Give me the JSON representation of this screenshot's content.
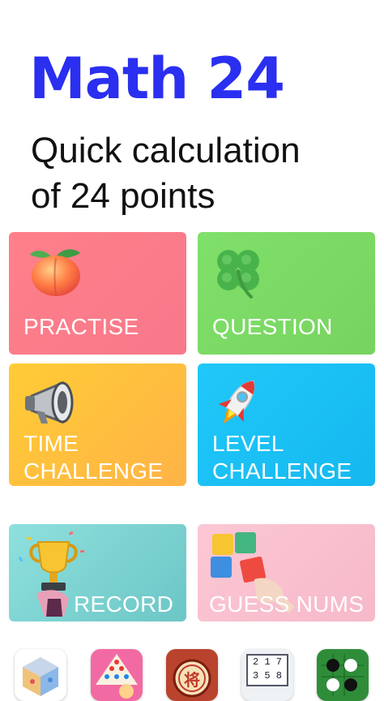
{
  "header": {
    "title": "Math 24",
    "subtitle_line1": "Quick calculation",
    "subtitle_line2": "of 24 points"
  },
  "cards": {
    "practise": {
      "label": "PRACTISE",
      "icon": "peach-icon"
    },
    "question": {
      "label": "QUESTION",
      "icon": "clover-icon"
    },
    "time": {
      "label_line1": "TIME",
      "label_line2": "CHALLENGE",
      "icon": "megaphone-icon"
    },
    "level": {
      "label_line1": "LEVEL",
      "label_line2": "CHALLENGE",
      "icon": "rocket-icon"
    },
    "record": {
      "label": "RECORD",
      "icon": "trophy-icon"
    },
    "guess": {
      "label": "GUESS NUMS",
      "icon": "puzzle-icon"
    }
  },
  "app_row": {
    "apps": [
      {
        "name": "cube-app-icon"
      },
      {
        "name": "checkers-app-icon"
      },
      {
        "name": "chinese-chess-app-icon",
        "glyph": "将"
      },
      {
        "name": "sudoku-app-icon",
        "digits_row1": "2 1 7",
        "digits_row2": "3 5 8"
      },
      {
        "name": "go-app-icon"
      }
    ]
  },
  "colors": {
    "title": "#2a2ff0",
    "practise": "#f7798a",
    "question": "#77d35f",
    "time": "#ffbf3f",
    "level": "#17bff4",
    "record": "#7fd6d4",
    "guess": "#f9bfd0"
  }
}
